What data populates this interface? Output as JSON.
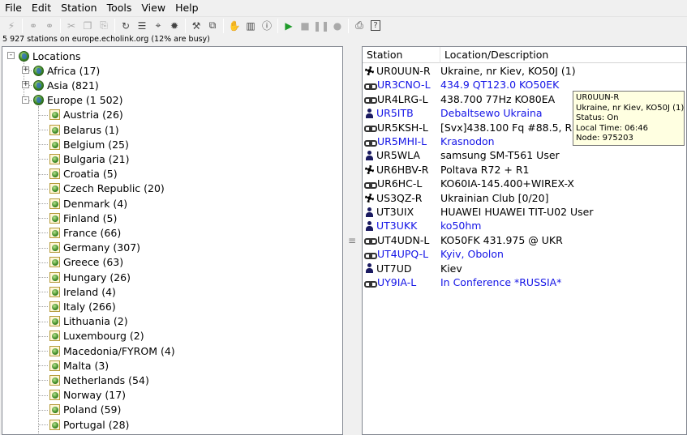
{
  "menu": {
    "items": [
      "File",
      "Edit",
      "Station",
      "Tools",
      "View",
      "Help"
    ]
  },
  "toolbar": {
    "buttons": [
      {
        "icon": "disconnect-icon",
        "enabled": false
      },
      {
        "icon": "connect-icon",
        "enabled": false
      },
      {
        "icon": "link-icon",
        "enabled": false
      },
      {
        "icon": "cut-icon",
        "enabled": false
      },
      {
        "icon": "copy-icon",
        "enabled": false
      },
      {
        "icon": "paste-icon",
        "enabled": false
      },
      {
        "icon": "refresh-icon",
        "enabled": true
      },
      {
        "icon": "list-icon",
        "enabled": true
      },
      {
        "icon": "find-icon",
        "enabled": true
      },
      {
        "icon": "sparkle-icon",
        "enabled": true
      },
      {
        "icon": "tools-icon",
        "enabled": true
      },
      {
        "icon": "windows-icon",
        "enabled": true
      },
      {
        "icon": "hand-icon",
        "enabled": true
      },
      {
        "icon": "book-icon",
        "enabled": true
      },
      {
        "icon": "info-icon",
        "enabled": true
      },
      {
        "icon": "play-icon",
        "enabled": true
      },
      {
        "icon": "stop-icon",
        "enabled": false
      },
      {
        "icon": "pause-icon",
        "enabled": false
      },
      {
        "icon": "record-icon",
        "enabled": false
      },
      {
        "icon": "print-icon",
        "enabled": true
      },
      {
        "icon": "help-icon",
        "enabled": true
      }
    ]
  },
  "status": {
    "text": "5 927 stations on europe.echolink.org (12% are busy)"
  },
  "tree": {
    "root": "Locations",
    "continents": [
      {
        "label": "Africa (17)",
        "expanded": false
      },
      {
        "label": "Asia (821)",
        "expanded": false
      },
      {
        "label": "Europe (1 502)",
        "expanded": true
      }
    ],
    "countries": [
      "Austria (26)",
      "Belarus (1)",
      "Belgium (25)",
      "Bulgaria (21)",
      "Croatia (5)",
      "Czech Republic (20)",
      "Denmark (4)",
      "Finland (5)",
      "France (66)",
      "Germany (307)",
      "Greece (63)",
      "Hungary (26)",
      "Ireland (4)",
      "Italy (266)",
      "Lithuania (2)",
      "Luxembourg (2)",
      "Macedonia/FYROM (4)",
      "Malta (3)",
      "Netherlands (54)",
      "Norway (17)",
      "Poland (59)",
      "Portugal (28)"
    ]
  },
  "list": {
    "columns": [
      "Station",
      "Location/Description"
    ],
    "rows": [
      {
        "station": "UR0UUN-R",
        "location": "Ukraine, nr Kiev, KO50J (1)",
        "icon": "repeater-icon",
        "busy": false
      },
      {
        "station": "UR3CNO-L",
        "location": "434.9 QT123.0 KO50EK",
        "icon": "link-icon",
        "busy": true
      },
      {
        "station": "UR4LRG-L",
        "location": "438.700 77Hz KO80EA",
        "icon": "link-icon",
        "busy": false
      },
      {
        "station": "UR5ITB",
        "location": "Debaltsewo Ukraina",
        "icon": "user-icon",
        "busy": true
      },
      {
        "station": "UR5KSH-L",
        "location": "[Svx]438.100 Fq #88.5, Rivn",
        "icon": "link-icon",
        "busy": false
      },
      {
        "station": "UR5MHI-L",
        "location": "Krasnodon",
        "icon": "link-icon",
        "busy": true
      },
      {
        "station": "UR5WLA",
        "location": "samsung SM-T561 User",
        "icon": "user-icon",
        "busy": false
      },
      {
        "station": "UR6HBV-R",
        "location": "Poltava R72 + R1",
        "icon": "repeater-icon",
        "busy": false
      },
      {
        "station": "UR6HC-L",
        "location": "KO60IA-145.400+WIREX-X",
        "icon": "link-icon",
        "busy": false
      },
      {
        "station": "US3QZ-R",
        "location": "Ukrainian Club [0/20]",
        "icon": "repeater-icon",
        "busy": false
      },
      {
        "station": "UT3UIX",
        "location": "HUAWEI HUAWEI TIT-U02 User",
        "icon": "user-icon",
        "busy": false
      },
      {
        "station": "UT3UKK",
        "location": "ko50hm",
        "icon": "user-icon",
        "busy": true
      },
      {
        "station": "UT4UDN-L",
        "location": "KO50FK 431.975 @ UKR",
        "icon": "link-icon",
        "busy": false
      },
      {
        "station": "UT4UPQ-L",
        "location": "Kyiv, Obolon",
        "icon": "link-icon",
        "busy": true
      },
      {
        "station": "UT7UD",
        "location": "Kiev",
        "icon": "user-icon",
        "busy": false
      },
      {
        "station": "UY9IA-L",
        "location": "In Conference *RUSSIA*",
        "icon": "link-icon",
        "busy": true
      }
    ]
  },
  "tooltip": {
    "lines": [
      "UR0UUN-R",
      "Ukraine, nr Kiev, KO50J (1)",
      "Status: On",
      "Local Time: 06:46",
      "Node: 975203"
    ]
  },
  "colors": {
    "busy_text": "#1414e6",
    "normal_text": "#000000"
  }
}
